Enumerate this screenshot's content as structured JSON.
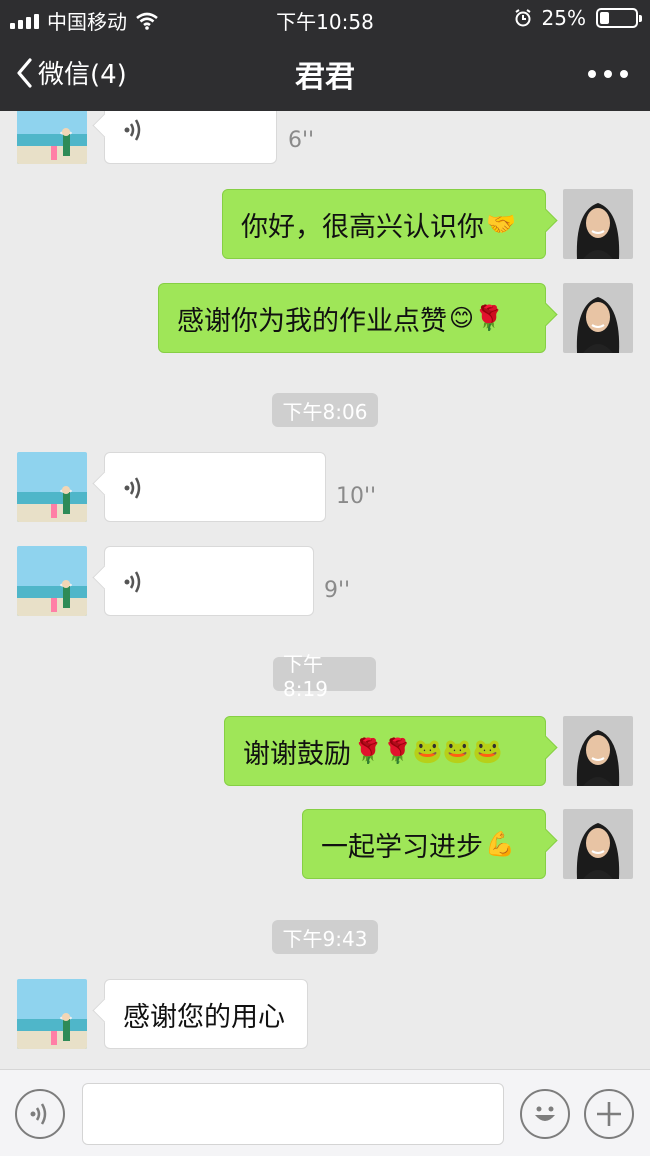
{
  "status_bar": {
    "carrier": "中国移动",
    "time": "下午10:58",
    "battery_percent": "25%",
    "battery_level": 0.25
  },
  "nav": {
    "back_label": "微信(4)",
    "title": "君君"
  },
  "messages": [
    {
      "id": "m1",
      "side": "in",
      "type": "voice",
      "duration": "6''"
    },
    {
      "id": "m2",
      "side": "out",
      "type": "text",
      "text": "你好，很高兴认识你",
      "emoji": "🤝"
    },
    {
      "id": "m3",
      "side": "out",
      "type": "text",
      "text": "感谢你为我的作业点赞",
      "emoji": "😊🌹"
    },
    {
      "id": "t1",
      "type": "timestamp",
      "text": "下午8:06"
    },
    {
      "id": "m4",
      "side": "in",
      "type": "voice",
      "duration": "10''"
    },
    {
      "id": "m5",
      "side": "in",
      "type": "voice",
      "duration": "9''"
    },
    {
      "id": "t2",
      "type": "timestamp",
      "text": "下午8:19"
    },
    {
      "id": "m6",
      "side": "out",
      "type": "text",
      "text": "谢谢鼓励",
      "emoji": "🌹🌹🐸🐸🐸"
    },
    {
      "id": "m7",
      "side": "out",
      "type": "text",
      "text": "一起学习进步",
      "emoji": "💪"
    },
    {
      "id": "t3",
      "type": "timestamp",
      "text": "下午9:43"
    },
    {
      "id": "m8",
      "side": "in",
      "type": "text",
      "text": "感谢您的用心"
    }
  ],
  "input_bar": {
    "voice_icon": "voice-icon",
    "emoji_icon": "smiley-icon",
    "add_icon": "plus-icon",
    "text_value": ""
  },
  "colors": {
    "nav_background": "#2e2e30",
    "chat_background": "#ebebeb",
    "outgoing_bubble": "#9fe658",
    "incoming_bubble": "#ffffff",
    "timestamp_background": "#cfcfcf"
  }
}
